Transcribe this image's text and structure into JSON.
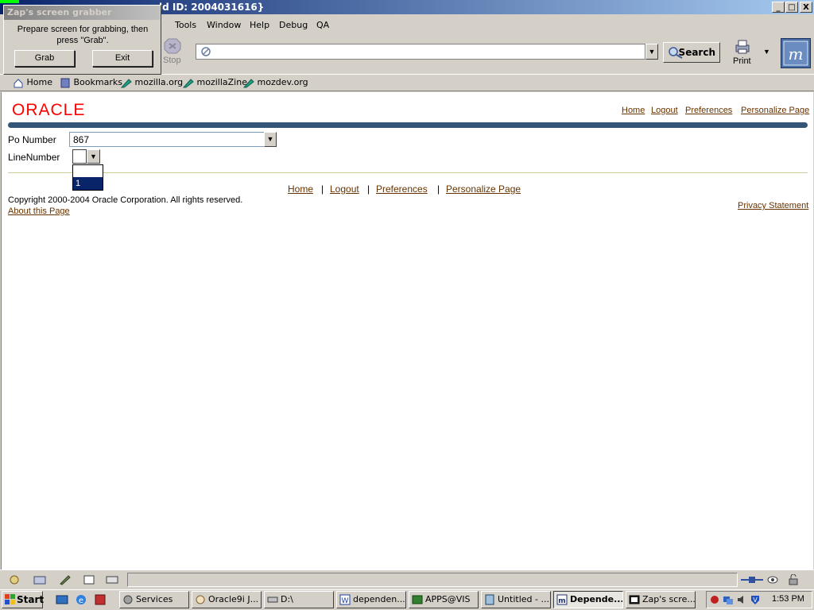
{
  "window": {
    "title": "ld ID: 2004031616}",
    "min_label": "_",
    "max_label": "□",
    "close_label": "X"
  },
  "menu": {
    "items": [
      "Tools",
      "Window",
      "Help",
      "Debug",
      "QA"
    ]
  },
  "toolbar": {
    "stop_label": "Stop",
    "url_value": "",
    "search_label": "Search",
    "print_label": "Print"
  },
  "bookmarks": {
    "items": [
      "Home",
      "Bookmarks",
      "mozilla.org",
      "mozillaZine",
      "mozdev.org"
    ]
  },
  "popup": {
    "title": "Zap's screen grabber",
    "message": "Prepare screen for grabbing, then press \"Grab\".",
    "grab_label": "Grab",
    "exit_label": "Exit"
  },
  "page": {
    "logo": "ORACLE",
    "global_links": [
      "Home",
      "Logout",
      "Preferences",
      "Personalize Page"
    ],
    "po_number_label": "Po Number",
    "po_number_value": "867",
    "line_number_label": "LineNumber",
    "line_number_options": [
      "",
      "1"
    ],
    "footer_links": [
      "Home",
      "Logout",
      "Preferences",
      "Personalize Page"
    ],
    "footer_separator": "|",
    "copyright": "Copyright 2000-2004 Oracle Corporation. All rights reserved.",
    "about_link": "About this Page",
    "privacy_link": "Privacy Statement"
  },
  "taskbar": {
    "start_label": "Start",
    "tasks": [
      "Services",
      "Oracle9i J...",
      "D:\\",
      "dependen...",
      "APPS@VIS",
      "Untitled - ...",
      "Depende...",
      "Zap's scre..."
    ],
    "active_task": "Depende...",
    "clock": "1:53 PM"
  },
  "colors": {
    "oracle_red": "#ff0000",
    "link_brown": "#663300",
    "band_blue": "#335577",
    "title_blue": "#0a246a",
    "selection": "#0a246a"
  }
}
